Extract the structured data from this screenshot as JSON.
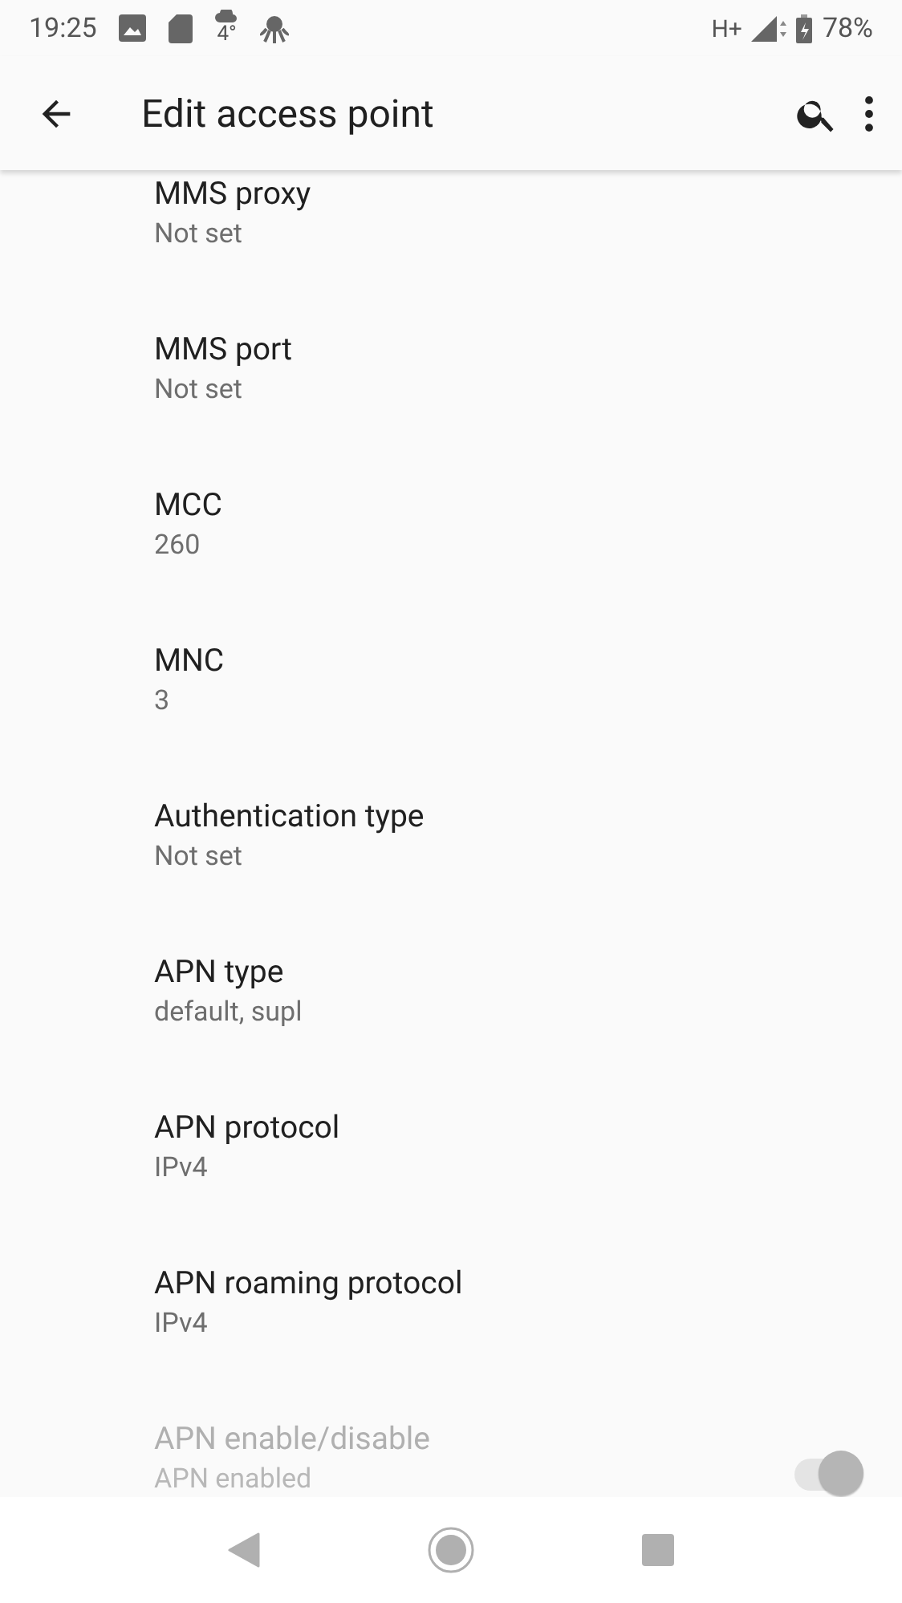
{
  "status_bar": {
    "time": "19:25",
    "weather_temp": "4°",
    "network_type": "H+",
    "battery": "78%"
  },
  "app_bar": {
    "title": "Edit access point"
  },
  "items": [
    {
      "kind": "text",
      "title": "MMS proxy",
      "summary": "Not set",
      "disabled": false
    },
    {
      "kind": "text",
      "title": "MMS port",
      "summary": "Not set",
      "disabled": false
    },
    {
      "kind": "text",
      "title": "MCC",
      "summary": "260",
      "disabled": false
    },
    {
      "kind": "text",
      "title": "MNC",
      "summary": "3",
      "disabled": false
    },
    {
      "kind": "text",
      "title": "Authentication type",
      "summary": "Not set",
      "disabled": false
    },
    {
      "kind": "text",
      "title": "APN type",
      "summary": "default, supl",
      "disabled": false
    },
    {
      "kind": "text",
      "title": "APN protocol",
      "summary": "IPv4",
      "disabled": false
    },
    {
      "kind": "text",
      "title": "APN roaming protocol",
      "summary": "IPv4",
      "disabled": false
    },
    {
      "kind": "switch",
      "title": "APN enable/disable",
      "summary": "APN enabled",
      "disabled": true,
      "on": true
    }
  ]
}
